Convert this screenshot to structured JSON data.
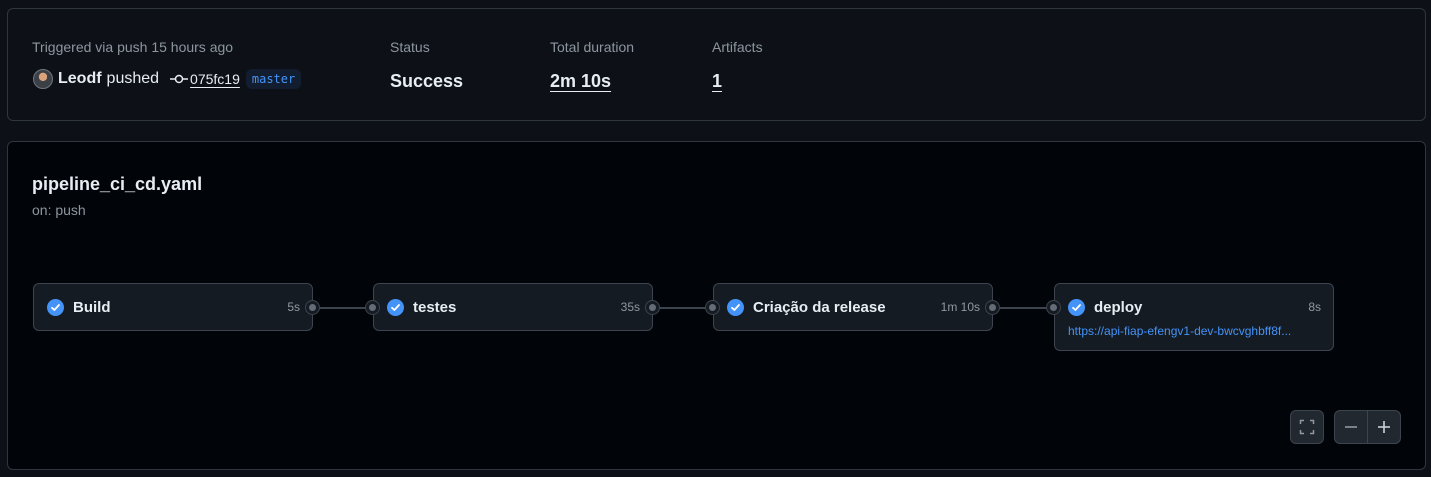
{
  "summary": {
    "trigger_label": "Triggered via push 15 hours ago",
    "actor": "Leodf",
    "action": "pushed",
    "commit_sha": "075fc19",
    "branch": "master",
    "status_label": "Status",
    "status_value": "Success",
    "duration_label": "Total duration",
    "duration_value": "2m 10s",
    "artifacts_label": "Artifacts",
    "artifacts_value": "1"
  },
  "workflow": {
    "title": "pipeline_ci_cd.yaml",
    "trigger": "on: push",
    "jobs": [
      {
        "name": "Build",
        "duration": "5s",
        "status": "success"
      },
      {
        "name": "testes",
        "duration": "35s",
        "status": "success"
      },
      {
        "name": "Criação da release",
        "duration": "1m 10s",
        "status": "success"
      },
      {
        "name": "deploy",
        "duration": "8s",
        "status": "success",
        "url": "https://api-fiap-efengv1-dev-bwcvghbff8f..."
      }
    ]
  },
  "colors": {
    "accent": "#4493f8",
    "background": "#0d1117",
    "graph_background": "#010409",
    "border": "#30363d"
  },
  "icons": [
    "avatar",
    "commit-icon",
    "check-circle-icon",
    "fullscreen-icon",
    "minus-icon",
    "plus-icon"
  ]
}
